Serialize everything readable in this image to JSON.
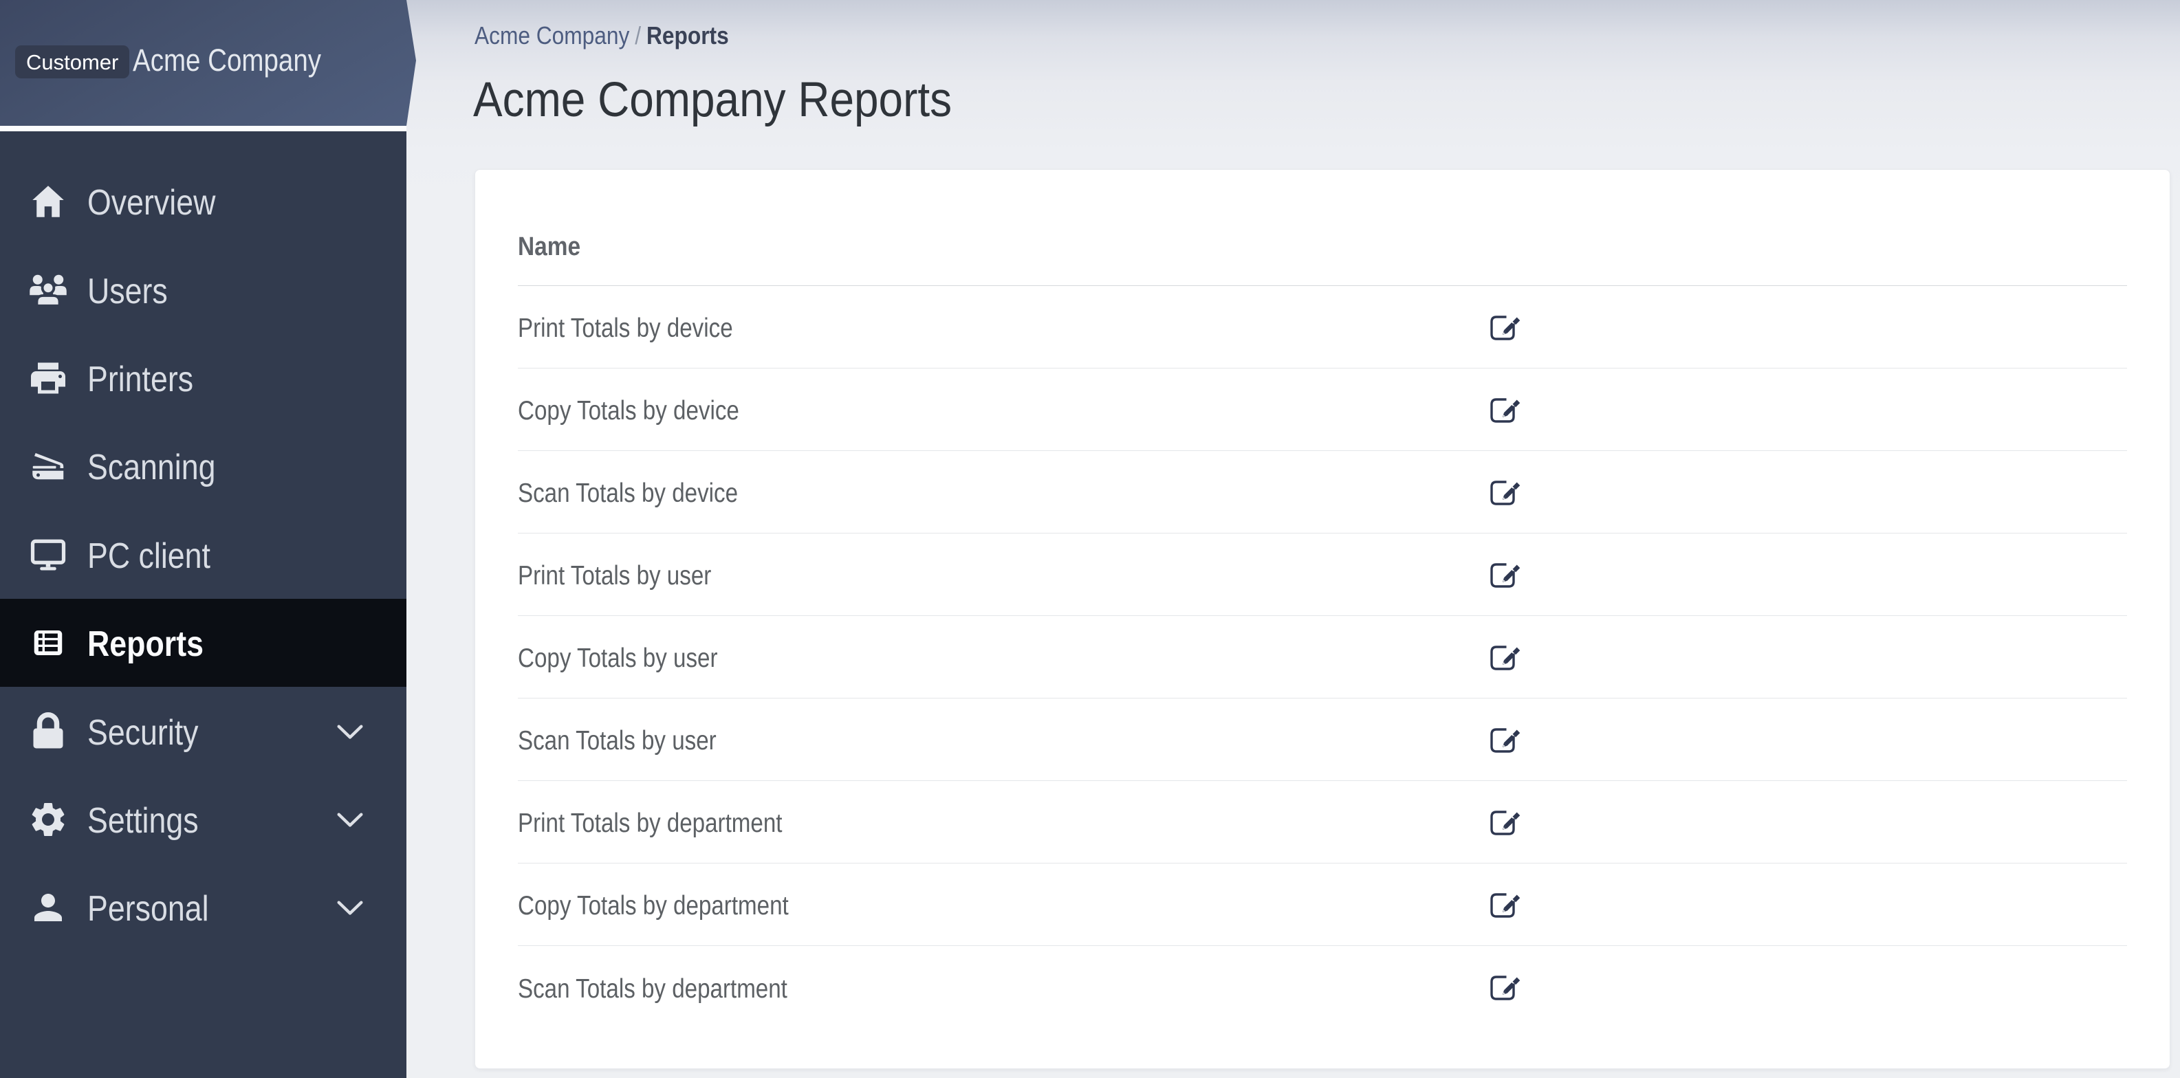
{
  "banner": {
    "badge_label": "Customer",
    "company_name": "Acme Company"
  },
  "sidebar": {
    "items": [
      {
        "id": "overview",
        "label": "Overview",
        "icon": "home-icon",
        "active": false,
        "expandable": false
      },
      {
        "id": "users",
        "label": "Users",
        "icon": "users-icon",
        "active": false,
        "expandable": false
      },
      {
        "id": "printers",
        "label": "Printers",
        "icon": "printer-icon",
        "active": false,
        "expandable": false
      },
      {
        "id": "scanning",
        "label": "Scanning",
        "icon": "scanner-icon",
        "active": false,
        "expandable": false
      },
      {
        "id": "pc-client",
        "label": "PC client",
        "icon": "desktop-icon",
        "active": false,
        "expandable": false
      },
      {
        "id": "reports",
        "label": "Reports",
        "icon": "table-icon",
        "active": true,
        "expandable": false
      },
      {
        "id": "security",
        "label": "Security",
        "icon": "lock-icon",
        "active": false,
        "expandable": true
      },
      {
        "id": "settings",
        "label": "Settings",
        "icon": "gear-icon",
        "active": false,
        "expandable": true
      },
      {
        "id": "personal",
        "label": "Personal",
        "icon": "person-icon",
        "active": false,
        "expandable": true
      }
    ]
  },
  "breadcrumb": {
    "parent": "Acme Company",
    "separator": "/",
    "current": "Reports"
  },
  "page_title": "Acme Company Reports",
  "reports_table": {
    "name_header": "Name",
    "row_action_icon": "edit-icon",
    "rows": [
      {
        "name": "Print Totals by device"
      },
      {
        "name": "Copy Totals by device"
      },
      {
        "name": "Scan Totals by device"
      },
      {
        "name": "Print Totals by user"
      },
      {
        "name": "Copy Totals by user"
      },
      {
        "name": "Scan Totals by user"
      },
      {
        "name": "Print Totals by department"
      },
      {
        "name": "Copy Totals by department"
      },
      {
        "name": "Scan Totals by department"
      }
    ]
  },
  "colors": {
    "sidebar_bg": "#323b4e",
    "sidebar_active_bg": "#0b0e14",
    "banner_gradient_start": "#3d4863",
    "banner_gradient_end": "#4f5e7e",
    "badge_bg": "#343c50",
    "breadcrumb_link": "#4d5c80",
    "heading_text": "#2f343a",
    "table_text": "#5c6064",
    "edit_icon": "#2e3750",
    "card_bg": "#ffffff"
  }
}
